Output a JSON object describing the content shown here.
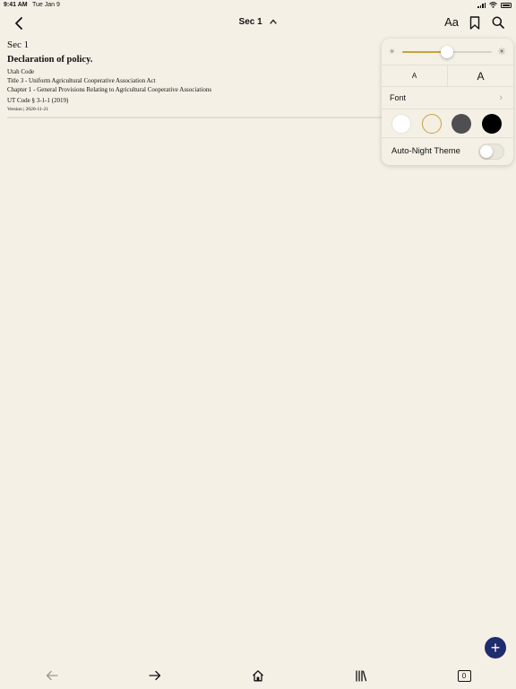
{
  "status_bar": {
    "time": "9:41 AM",
    "date": "Tue Jan 9"
  },
  "nav": {
    "title": "Sec 1",
    "title_chevron": "⌃",
    "text_size_label": "Aa"
  },
  "document": {
    "section": "Sec 1",
    "heading": "Declaration of policy.",
    "lines": [
      "Utah Code",
      "Title 3 - Uniform Agricultural Cooperative Association Act",
      "Chapter 1 - General Provisions Relating to Agricultural Cooperative Associations"
    ],
    "citation": "UT Code § 3-1-1 (2019)",
    "version": "Version | 2020-11-21"
  },
  "popover": {
    "brightness_level": 0.5,
    "font_size_small_label": "A",
    "font_size_large_label": "A",
    "font_label": "Font",
    "font_chevron": "›",
    "themes": [
      {
        "name": "white",
        "color": "#ffffff",
        "selected": false
      },
      {
        "name": "sepia",
        "color": "#f4efe3",
        "selected": true
      },
      {
        "name": "gray",
        "color": "#4f4f51",
        "selected": false
      },
      {
        "name": "night",
        "color": "#000000",
        "selected": false
      }
    ],
    "auto_night_label": "Auto-Night Theme",
    "auto_night_on": false
  },
  "fab": {
    "label": "+"
  },
  "bottom_bar": {
    "tab_count": "0"
  },
  "colors": {
    "background": "#f5f0e6",
    "accent": "#c8a23c",
    "fab": "#1d2d6e"
  }
}
